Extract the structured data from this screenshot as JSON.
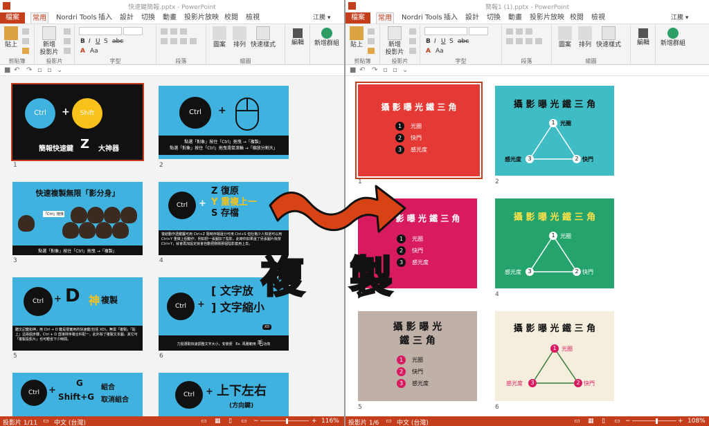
{
  "left_window": {
    "title": "快速鍵簡報.pptx - PowerPoint",
    "user": "江騰 ▾",
    "tabs": [
      "檔案",
      "常用",
      "Nordri Tools",
      "插入",
      "設計",
      "切換",
      "動畫",
      "投影片放映",
      "校閱",
      "檢視"
    ],
    "ribbon": {
      "paste": "貼上",
      "new_slide": "新增\n投影片",
      "shapes": "圖案",
      "arrange": "排列",
      "quick_styles": "快速樣式",
      "edit": "編輯",
      "new_group": "新增群組",
      "groups": [
        "剪貼簿",
        "投影片",
        "字型",
        "段落",
        "繪圖"
      ]
    },
    "status": {
      "slide": "投影片 1/11",
      "lang": "中文 (台灣)",
      "zoom": "116%"
    }
  },
  "right_window": {
    "title": "簡報1 (1).pptx - PowerPoint",
    "user": "江騰 ▾",
    "tabs": [
      "檔案",
      "常用",
      "Nordri Tools",
      "插入",
      "設計",
      "切換",
      "動畫",
      "投影片放映",
      "校閱",
      "檢視"
    ],
    "ribbon": {
      "paste": "貼上",
      "new_slide": "新增\n投影片",
      "shapes": "圖案",
      "arrange": "排列",
      "quick_styles": "快速樣式",
      "edit": "編輯",
      "new_group": "新增群組",
      "groups": [
        "剪貼簿",
        "投影片",
        "字型",
        "段落",
        "繪圖"
      ]
    },
    "status": {
      "slide": "投影片 1/6",
      "lang": "中文 (台灣)",
      "zoom": "108%"
    }
  },
  "left_slides": [
    {
      "num": "1",
      "ctrl": "Ctrl",
      "shift": "Shift",
      "plus": "+",
      "caption": "簡報快速鍵",
      "big": "Z",
      "suffix": "大神器"
    },
    {
      "num": "2",
      "ctrl": "Ctrl",
      "plus": "+",
      "line1": "點選「對象」按住「Ctrl」拖曳 →「複製」",
      "line2": "點選「對象」按住「Ctrl」拖曳滑鼠滾輪 →「縮放分割大」"
    },
    {
      "num": "3",
      "title": "快速複製無限「影分身」",
      "ctrl_label": "「Ctrl」拖曳",
      "footer": "點選「對象」按住「Ctrl」拖曳 →「複製」"
    },
    {
      "num": "4",
      "ctrl": "Ctrl",
      "plus": "+",
      "l1k": "Z",
      "l1": "復原",
      "l2k": "Y",
      "l2": "重複上一",
      "l3k": "S",
      "l3": "存檔",
      "body": "復結動作透鍵屬可用 Ctrl+Z 隨時存檔還分可用 Ctrl+S 但社格少人知道可以用 Ctrl+Y 重做上個動作，例如把一張圖加了陰影，此時你如果還了另張圖片後按 Ctrl+Y，就會再加設定就會自動把剛剛那個陰影套用上去。"
    },
    {
      "num": "5",
      "ctrl": "Ctrl",
      "plus": "+",
      "key": "D",
      "god": "神",
      "copy": "複製",
      "body": "聽文記鍵如神，用 Ctrl + D 鍵是很實用的快速鍵(包括 XD)，無需「複製」「貼上」這兩個步驟，Ctrl + D 直接排序複合匹配一，此外除了複製文本圖，其它可「複製投影片」也可輕省下少時間。"
    },
    {
      "num": "6",
      "ctrl": "Ctrl",
      "plus": "+",
      "b1": "[",
      "t1": "文字放",
      "b2": "]",
      "t2": "文字縮小",
      "tag": "XD",
      "foot": "力挺選取快速調整文字大小，安裝便",
      "foot2": "Ex. 馬雅範用",
      "mao": "毛",
      "mao2": "功效"
    },
    {
      "num": "7",
      "ctrl": "Ctrl",
      "plus": "+",
      "g": "G",
      "g_label": "組合",
      "sg": "Shift+G",
      "sg_label": "取消組合"
    },
    {
      "num": "8",
      "ctrl": "Ctrl",
      "plus": "+",
      "title": "上下左右",
      "sub": "(方向鍵)"
    }
  ],
  "right_slides": [
    {
      "num": "1",
      "title": "攝 影 曝 光 鐵 三 角",
      "items": [
        "光圈",
        "快門",
        "感光度"
      ],
      "marks": [
        "1",
        "2",
        "3"
      ]
    },
    {
      "num": "2",
      "title": "攝 影 曝 光 鐵 三 角",
      "items": [
        "光圈",
        "快門",
        "感光度"
      ],
      "marks": [
        "1",
        "2",
        "3"
      ]
    },
    {
      "num": "3",
      "title": "影 曝 光 鐵 三 角",
      "items": [
        "光圈",
        "快門",
        "感光度"
      ],
      "marks": [
        "1",
        "2",
        "3"
      ]
    },
    {
      "num": "4",
      "title": "攝 影 曝 光 鐵 三 角",
      "items": [
        "光圈",
        "快門",
        "感光度"
      ],
      "marks": [
        "1",
        "2",
        "3"
      ]
    },
    {
      "num": "5",
      "title1": "攝 影 曝 光",
      "title2": "鐵 三 角",
      "items": [
        "光圈",
        "快門",
        "感光度"
      ],
      "marks": [
        "1",
        "2",
        "3"
      ]
    },
    {
      "num": "6",
      "title": "攝 影 曝 光 鐵 三 角",
      "items": [
        "光圈",
        "快門",
        "感光度"
      ],
      "marks": [
        "1",
        "2",
        "3"
      ]
    }
  ],
  "overlay": {
    "char1": "複",
    "char2": "製"
  },
  "colors": {
    "accent": "#c43e1c",
    "slide_blue": "#3fb2df",
    "red": "#e53935",
    "teal": "#3fbcc4",
    "crimson": "#d81b60",
    "green": "#24a46c",
    "taupe": "#bfb0a8",
    "cream": "#f6eedd",
    "arrow": "#d84315"
  }
}
